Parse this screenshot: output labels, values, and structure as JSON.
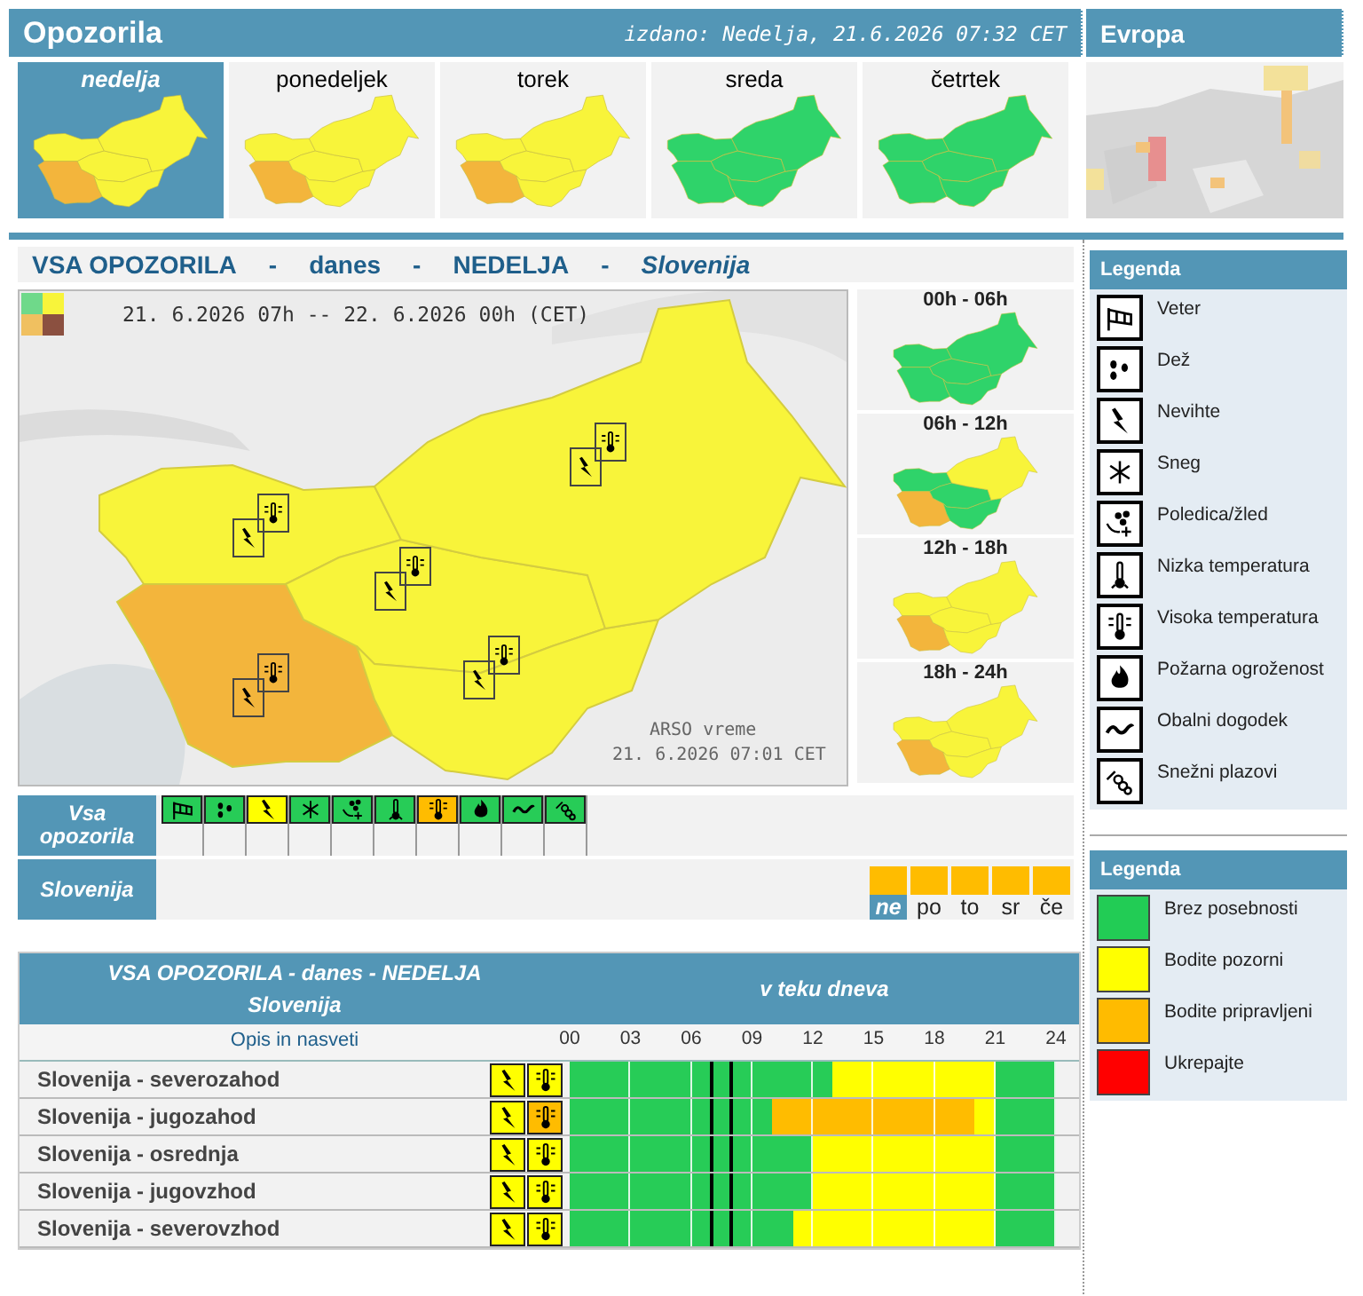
{
  "header": {
    "title": "Opozorila",
    "issued": "izdano: Nedelja, 21.6.2026 07:32 CET",
    "europe": "Evropa"
  },
  "days": [
    {
      "label": "nedelja",
      "selected": true,
      "regions": [
        {
          "color": "#f8f43a"
        },
        {
          "color": "#f3b53c"
        },
        {
          "color": "#f8f43a"
        },
        {
          "color": "#f8f43a"
        },
        {
          "color": "#f8f43a"
        }
      ]
    },
    {
      "label": "ponedeljek",
      "selected": false,
      "regions": [
        {
          "color": "#f8f43a"
        },
        {
          "color": "#f3b53c"
        },
        {
          "color": "#f8f43a"
        },
        {
          "color": "#f8f43a"
        },
        {
          "color": "#f8f43a"
        }
      ]
    },
    {
      "label": "torek",
      "selected": false,
      "regions": [
        {
          "color": "#f8f43a"
        },
        {
          "color": "#f3b53c"
        },
        {
          "color": "#f8f43a"
        },
        {
          "color": "#f8f43a"
        },
        {
          "color": "#f8f43a"
        }
      ]
    },
    {
      "label": "sreda",
      "selected": false,
      "regions": [
        {
          "color": "#2fd36a"
        },
        {
          "color": "#2fd36a"
        },
        {
          "color": "#2fd36a"
        },
        {
          "color": "#2fd36a"
        },
        {
          "color": "#2fd36a"
        }
      ]
    },
    {
      "label": "četrtek",
      "selected": false,
      "regions": [
        {
          "color": "#2fd36a"
        },
        {
          "color": "#2fd36a"
        },
        {
          "color": "#2fd36a"
        },
        {
          "color": "#2fd36a"
        },
        {
          "color": "#2fd36a"
        }
      ]
    }
  ],
  "section": {
    "parts": [
      "VSA OPOZORILA",
      "-",
      "danes",
      "-",
      "NEDELJA",
      "-",
      "Slovenija"
    ]
  },
  "map": {
    "period": "21. 6.2026 07h -- 22. 6.2026 00h (CET)",
    "source": "ARSO vreme",
    "stamp": "21. 6.2026 07:01 CET",
    "regions": [
      {
        "color": "#f8f43a",
        "warnings": [
          {
            "kind": "storm"
          },
          {
            "kind": "heat"
          }
        ]
      },
      {
        "color": "#f3b53c",
        "warnings": [
          {
            "kind": "storm"
          },
          {
            "kind": "heat"
          }
        ]
      },
      {
        "color": "#f8f43a",
        "warnings": [
          {
            "kind": "storm"
          },
          {
            "kind": "heat"
          }
        ]
      },
      {
        "color": "#f8f43a",
        "warnings": [
          {
            "kind": "storm"
          },
          {
            "kind": "heat"
          }
        ]
      },
      {
        "color": "#f8f43a",
        "warnings": [
          {
            "kind": "storm"
          },
          {
            "kind": "heat"
          }
        ]
      }
    ]
  },
  "periods": [
    {
      "label": "00h - 06h",
      "regions": [
        {
          "color": "#2fd36a"
        },
        {
          "color": "#2fd36a"
        },
        {
          "color": "#2fd36a"
        },
        {
          "color": "#2fd36a"
        },
        {
          "color": "#2fd36a"
        }
      ]
    },
    {
      "label": "06h - 12h",
      "regions": [
        {
          "color": "#2fd36a"
        },
        {
          "color": "#f3b53c"
        },
        {
          "color": "#2fd36a"
        },
        {
          "color": "#2fd36a"
        },
        {
          "color": "#f8f43a"
        }
      ]
    },
    {
      "label": "12h - 18h",
      "regions": [
        {
          "color": "#f8f43a"
        },
        {
          "color": "#f3b53c"
        },
        {
          "color": "#f8f43a"
        },
        {
          "color": "#f8f43a"
        },
        {
          "color": "#f8f43a"
        }
      ]
    },
    {
      "label": "18h - 24h",
      "regions": [
        {
          "color": "#f8f43a"
        },
        {
          "color": "#f3b53c"
        },
        {
          "color": "#f8f43a"
        },
        {
          "color": "#f8f43a"
        },
        {
          "color": "#f8f43a"
        }
      ]
    }
  ],
  "overview": {
    "label": "Vsa opozorila",
    "warnings": [
      {
        "kind": "wind",
        "color": "#27cc57"
      },
      {
        "kind": "rain",
        "color": "#27cc57"
      },
      {
        "kind": "storm",
        "color": "#ffff00"
      },
      {
        "kind": "snow",
        "color": "#27cc57"
      },
      {
        "kind": "ice",
        "color": "#27cc57"
      },
      {
        "kind": "cold",
        "color": "#27cc57"
      },
      {
        "kind": "heat",
        "color": "#ffbc00"
      },
      {
        "kind": "fire",
        "color": "#27cc57"
      },
      {
        "kind": "coast",
        "color": "#27cc57"
      },
      {
        "kind": "avalanche",
        "color": "#27cc57"
      }
    ]
  },
  "region_row": {
    "label": "Slovenija",
    "days": [
      {
        "label": "ne",
        "selected": true,
        "color": "#ffbc00"
      },
      {
        "label": "po",
        "selected": false,
        "color": "#ffbc00"
      },
      {
        "label": "to",
        "selected": false,
        "color": "#ffbc00"
      },
      {
        "label": "sr",
        "selected": false,
        "color": "#ffbc00"
      },
      {
        "label": "če",
        "selected": false,
        "color": "#ffbc00"
      }
    ]
  },
  "table": {
    "title": "VSA OPOZORILA - danes - NEDELJA",
    "subtitle": "Slovenija",
    "timeline_title": "v teku dneva",
    "description": "Opis in nasveti",
    "hour_labels": [
      "00",
      "03",
      "06",
      "09",
      "12",
      "15",
      "18",
      "21",
      "24"
    ],
    "rows": [
      {
        "name": "Slovenija - severozahod",
        "icons": [
          {
            "kind": "storm",
            "color": "#ffff00"
          },
          {
            "kind": "heat",
            "color": "#ffff00"
          }
        ],
        "hours": [
          {
            "color": "#27cc57",
            "now": false
          },
          {
            "color": "#27cc57",
            "now": false
          },
          {
            "color": "#27cc57",
            "now": false
          },
          {
            "color": "#27cc57",
            "now": false
          },
          {
            "color": "#27cc57",
            "now": false
          },
          {
            "color": "#27cc57",
            "now": false
          },
          {
            "color": "#27cc57",
            "now": false
          },
          {
            "color": "#27cc57",
            "now": true
          },
          {
            "color": "#27cc57",
            "now": true
          },
          {
            "color": "#27cc57",
            "now": false
          },
          {
            "color": "#27cc57",
            "now": false
          },
          {
            "color": "#27cc57",
            "now": false
          },
          {
            "color": "#27cc57",
            "now": false
          },
          {
            "color": "#ffff00",
            "now": false
          },
          {
            "color": "#ffff00",
            "now": false
          },
          {
            "color": "#ffff00",
            "now": false
          },
          {
            "color": "#ffff00",
            "now": false
          },
          {
            "color": "#ffff00",
            "now": false
          },
          {
            "color": "#ffff00",
            "now": false
          },
          {
            "color": "#ffff00",
            "now": false
          },
          {
            "color": "#ffff00",
            "now": false
          },
          {
            "color": "#27cc57",
            "now": false
          },
          {
            "color": "#27cc57",
            "now": false
          },
          {
            "color": "#27cc57",
            "now": false
          }
        ]
      },
      {
        "name": "Slovenija - jugozahod",
        "icons": [
          {
            "kind": "storm",
            "color": "#ffff00"
          },
          {
            "kind": "heat",
            "color": "#ffbc00"
          }
        ],
        "hours": [
          {
            "color": "#27cc57",
            "now": false
          },
          {
            "color": "#27cc57",
            "now": false
          },
          {
            "color": "#27cc57",
            "now": false
          },
          {
            "color": "#27cc57",
            "now": false
          },
          {
            "color": "#27cc57",
            "now": false
          },
          {
            "color": "#27cc57",
            "now": false
          },
          {
            "color": "#27cc57",
            "now": false
          },
          {
            "color": "#27cc57",
            "now": true
          },
          {
            "color": "#27cc57",
            "now": true
          },
          {
            "color": "#27cc57",
            "now": false
          },
          {
            "color": "#ffbc00",
            "now": false
          },
          {
            "color": "#ffbc00",
            "now": false
          },
          {
            "color": "#ffbc00",
            "now": false
          },
          {
            "color": "#ffbc00",
            "now": false
          },
          {
            "color": "#ffbc00",
            "now": false
          },
          {
            "color": "#ffbc00",
            "now": false
          },
          {
            "color": "#ffbc00",
            "now": false
          },
          {
            "color": "#ffbc00",
            "now": false
          },
          {
            "color": "#ffbc00",
            "now": false
          },
          {
            "color": "#ffbc00",
            "now": false
          },
          {
            "color": "#ffff00",
            "now": false
          },
          {
            "color": "#27cc57",
            "now": false
          },
          {
            "color": "#27cc57",
            "now": false
          },
          {
            "color": "#27cc57",
            "now": false
          }
        ]
      },
      {
        "name": "Slovenija - osrednja",
        "icons": [
          {
            "kind": "storm",
            "color": "#ffff00"
          },
          {
            "kind": "heat",
            "color": "#ffff00"
          }
        ],
        "hours": [
          {
            "color": "#27cc57",
            "now": false
          },
          {
            "color": "#27cc57",
            "now": false
          },
          {
            "color": "#27cc57",
            "now": false
          },
          {
            "color": "#27cc57",
            "now": false
          },
          {
            "color": "#27cc57",
            "now": false
          },
          {
            "color": "#27cc57",
            "now": false
          },
          {
            "color": "#27cc57",
            "now": false
          },
          {
            "color": "#27cc57",
            "now": true
          },
          {
            "color": "#27cc57",
            "now": true
          },
          {
            "color": "#27cc57",
            "now": false
          },
          {
            "color": "#27cc57",
            "now": false
          },
          {
            "color": "#27cc57",
            "now": false
          },
          {
            "color": "#ffff00",
            "now": false
          },
          {
            "color": "#ffff00",
            "now": false
          },
          {
            "color": "#ffff00",
            "now": false
          },
          {
            "color": "#ffff00",
            "now": false
          },
          {
            "color": "#ffff00",
            "now": false
          },
          {
            "color": "#ffff00",
            "now": false
          },
          {
            "color": "#ffff00",
            "now": false
          },
          {
            "color": "#ffff00",
            "now": false
          },
          {
            "color": "#ffff00",
            "now": false
          },
          {
            "color": "#27cc57",
            "now": false
          },
          {
            "color": "#27cc57",
            "now": false
          },
          {
            "color": "#27cc57",
            "now": false
          }
        ]
      },
      {
        "name": "Slovenija - jugovzhod",
        "icons": [
          {
            "kind": "storm",
            "color": "#ffff00"
          },
          {
            "kind": "heat",
            "color": "#ffff00"
          }
        ],
        "hours": [
          {
            "color": "#27cc57",
            "now": false
          },
          {
            "color": "#27cc57",
            "now": false
          },
          {
            "color": "#27cc57",
            "now": false
          },
          {
            "color": "#27cc57",
            "now": false
          },
          {
            "color": "#27cc57",
            "now": false
          },
          {
            "color": "#27cc57",
            "now": false
          },
          {
            "color": "#27cc57",
            "now": false
          },
          {
            "color": "#27cc57",
            "now": true
          },
          {
            "color": "#27cc57",
            "now": true
          },
          {
            "color": "#27cc57",
            "now": false
          },
          {
            "color": "#27cc57",
            "now": false
          },
          {
            "color": "#27cc57",
            "now": false
          },
          {
            "color": "#ffff00",
            "now": false
          },
          {
            "color": "#ffff00",
            "now": false
          },
          {
            "color": "#ffff00",
            "now": false
          },
          {
            "color": "#ffff00",
            "now": false
          },
          {
            "color": "#ffff00",
            "now": false
          },
          {
            "color": "#ffff00",
            "now": false
          },
          {
            "color": "#ffff00",
            "now": false
          },
          {
            "color": "#ffff00",
            "now": false
          },
          {
            "color": "#ffff00",
            "now": false
          },
          {
            "color": "#27cc57",
            "now": false
          },
          {
            "color": "#27cc57",
            "now": false
          },
          {
            "color": "#27cc57",
            "now": false
          }
        ]
      },
      {
        "name": "Slovenija - severovzhod",
        "icons": [
          {
            "kind": "storm",
            "color": "#ffff00"
          },
          {
            "kind": "heat",
            "color": "#ffff00"
          }
        ],
        "hours": [
          {
            "color": "#27cc57",
            "now": false
          },
          {
            "color": "#27cc57",
            "now": false
          },
          {
            "color": "#27cc57",
            "now": false
          },
          {
            "color": "#27cc57",
            "now": false
          },
          {
            "color": "#27cc57",
            "now": false
          },
          {
            "color": "#27cc57",
            "now": false
          },
          {
            "color": "#27cc57",
            "now": false
          },
          {
            "color": "#27cc57",
            "now": true
          },
          {
            "color": "#27cc57",
            "now": true
          },
          {
            "color": "#27cc57",
            "now": false
          },
          {
            "color": "#27cc57",
            "now": false
          },
          {
            "color": "#ffff00",
            "now": false
          },
          {
            "color": "#ffff00",
            "now": false
          },
          {
            "color": "#ffff00",
            "now": false
          },
          {
            "color": "#ffff00",
            "now": false
          },
          {
            "color": "#ffff00",
            "now": false
          },
          {
            "color": "#ffff00",
            "now": false
          },
          {
            "color": "#ffff00",
            "now": false
          },
          {
            "color": "#ffff00",
            "now": false
          },
          {
            "color": "#ffff00",
            "now": false
          },
          {
            "color": "#ffff00",
            "now": false
          },
          {
            "color": "#27cc57",
            "now": false
          },
          {
            "color": "#27cc57",
            "now": false
          },
          {
            "color": "#27cc57",
            "now": false
          }
        ]
      }
    ]
  },
  "icon_legend": {
    "title": "Legenda",
    "items": [
      {
        "kind": "wind",
        "label": "Veter"
      },
      {
        "kind": "rain",
        "label": "Dež"
      },
      {
        "kind": "storm",
        "label": "Nevihte"
      },
      {
        "kind": "snow",
        "label": "Sneg"
      },
      {
        "kind": "ice",
        "label": "Poledica/žled"
      },
      {
        "kind": "cold",
        "label": "Nizka temperatura"
      },
      {
        "kind": "heat",
        "label": "Visoka temperatura"
      },
      {
        "kind": "fire",
        "label": "Požarna ogroženost"
      },
      {
        "kind": "coast",
        "label": "Obalni dogodek"
      },
      {
        "kind": "avalanche",
        "label": "Snežni plazovi"
      }
    ]
  },
  "color_legend": {
    "title": "Legenda",
    "items": [
      {
        "color": "#22cc55",
        "label": "Brez posebnosti"
      },
      {
        "color": "#ffff00",
        "label": "Bodite pozorni"
      },
      {
        "color": "#ffbb00",
        "label": "Bodite pripravljeni"
      },
      {
        "color": "#ff0000",
        "label": "Ukrepajte"
      }
    ]
  }
}
